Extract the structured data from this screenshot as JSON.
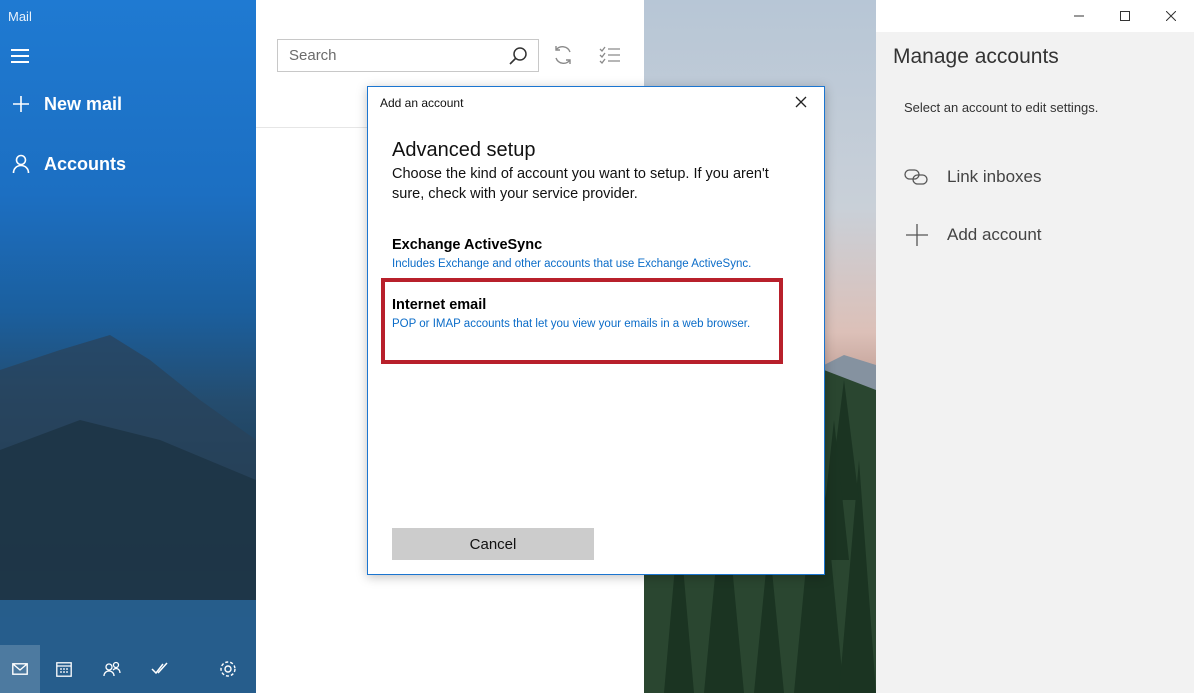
{
  "app": {
    "title": "Mail"
  },
  "nav": {
    "items": [
      {
        "label": "New mail",
        "icon": "plus-icon"
      },
      {
        "label": "Accounts",
        "icon": "person-icon"
      }
    ],
    "bottom_icons": [
      "mail-icon",
      "calendar-icon",
      "people-icon",
      "todo-icon",
      "settings-icon"
    ],
    "background_color": "#1f7ad2"
  },
  "list": {
    "search_placeholder": "Search"
  },
  "manage": {
    "title": "Manage accounts",
    "subtitle": "Select an account to edit settings.",
    "link_inboxes_label": "Link inboxes",
    "add_account_label": "Add account"
  },
  "dialog": {
    "title": "Add an account",
    "heading": "Advanced setup",
    "description": "Choose the kind of account you want to setup. If you aren't sure, check with your service provider.",
    "options": [
      {
        "title": "Exchange ActiveSync",
        "description": "Includes Exchange and other accounts that use Exchange ActiveSync."
      },
      {
        "title": "Internet email",
        "description": "POP or IMAP accounts that let you view your emails in a web browser."
      }
    ],
    "cancel_label": "Cancel",
    "accent_color": "#0b6cc8",
    "highlight_color": "#b8202b"
  }
}
